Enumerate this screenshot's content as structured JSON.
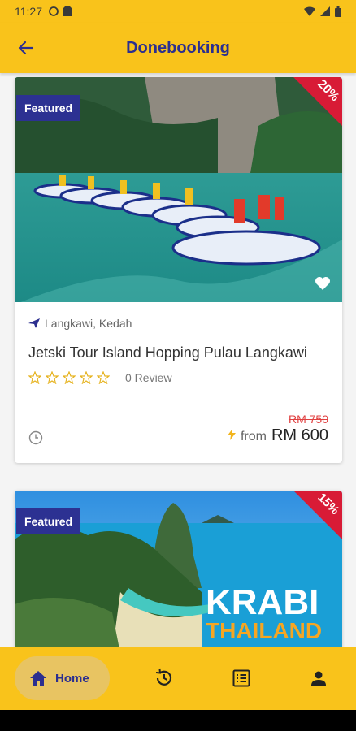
{
  "status_bar": {
    "time": "11:27"
  },
  "app_bar": {
    "title": "Donebooking"
  },
  "cards": [
    {
      "featured": "Featured",
      "discount": "20%",
      "location": "Langkawi, Kedah",
      "title": "Jetski Tour Island Hopping Pulau Langkawi",
      "rating_stars": 0,
      "review_text": "0 Review",
      "old_price": "RM 750",
      "from_label": "from",
      "price": "RM 600"
    },
    {
      "featured": "Featured",
      "discount": "15%",
      "image_text_1": "KRABI",
      "image_text_2": "THAILAND"
    }
  ],
  "bottom_nav": {
    "home_label": "Home"
  },
  "colors": {
    "brand_yellow": "#f9c31b",
    "brand_navy": "#2c2f8f",
    "discount_red": "#d81b36"
  }
}
